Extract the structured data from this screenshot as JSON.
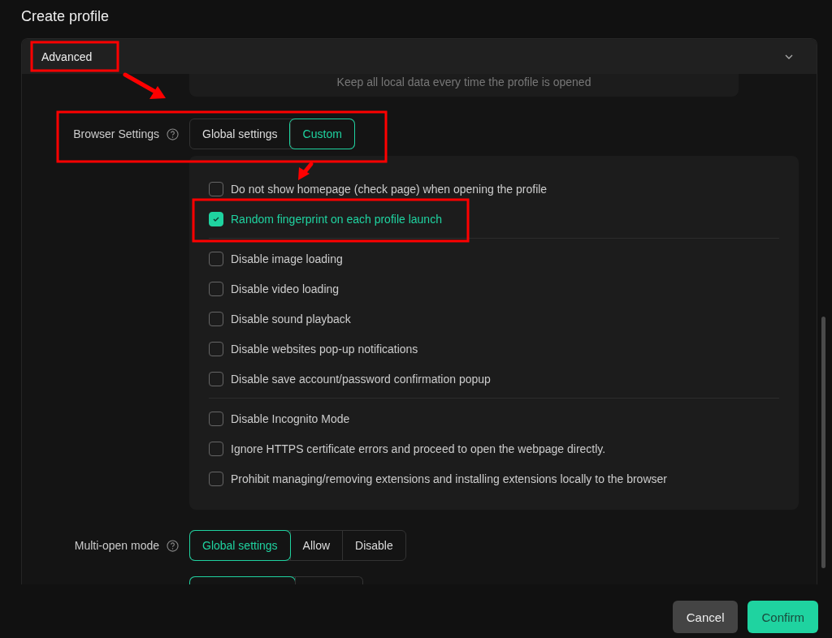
{
  "dialog": {
    "title": "Create profile"
  },
  "section": {
    "label": "Advanced",
    "expanded": true
  },
  "storage_note": "Keep all local data every time the profile is opened",
  "browser_settings": {
    "label": "Browser Settings",
    "options": [
      {
        "label": "Global settings",
        "selected": false
      },
      {
        "label": "Custom",
        "selected": true
      }
    ]
  },
  "checkbox_groups": [
    [
      {
        "label": "Do not show homepage (check page) when opening the profile",
        "checked": false
      },
      {
        "label": "Random fingerprint on each profile launch",
        "checked": true
      }
    ],
    [
      {
        "label": "Disable image loading",
        "checked": false
      },
      {
        "label": "Disable video loading",
        "checked": false
      },
      {
        "label": "Disable sound playback",
        "checked": false
      },
      {
        "label": "Disable websites pop-up notifications",
        "checked": false
      },
      {
        "label": "Disable save account/password confirmation popup",
        "checked": false
      }
    ],
    [
      {
        "label": "Disable Incognito Mode",
        "checked": false
      },
      {
        "label": "Ignore HTTPS certificate errors and proceed to open the webpage directly.",
        "checked": false
      },
      {
        "label": "Prohibit managing/removing extensions and installing extensions locally to the browser",
        "checked": false
      }
    ]
  ],
  "multi_open": {
    "label": "Multi-open mode",
    "options": [
      {
        "label": "Global settings",
        "selected": true
      },
      {
        "label": "Allow",
        "selected": false
      },
      {
        "label": "Disable",
        "selected": false
      }
    ]
  },
  "partial_toggle": [
    {
      "selected": true
    },
    {
      "selected": false
    }
  ],
  "buttons": [
    {
      "label": "Cancel",
      "kind": "secondary"
    },
    {
      "label": "Confirm",
      "kind": "primary"
    }
  ]
}
